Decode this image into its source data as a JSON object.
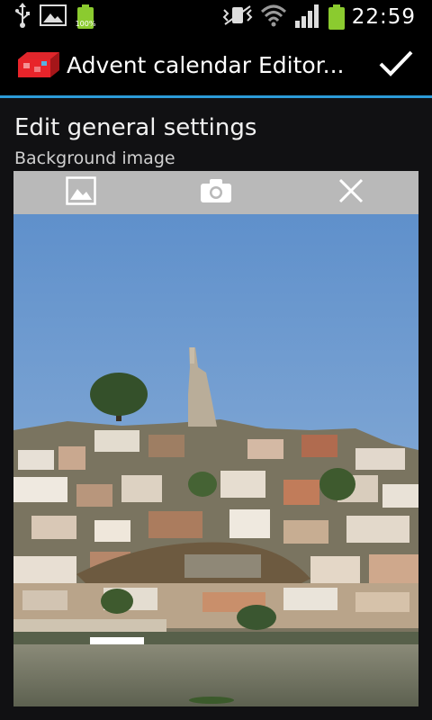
{
  "status_bar": {
    "battery_level_label": "100%",
    "time": "22:59",
    "icons": [
      "usb-icon",
      "image-notification-icon",
      "battery-icon",
      "vibrate-icon",
      "wifi-icon",
      "signal-icon",
      "battery-icon"
    ]
  },
  "action_bar": {
    "title": "Advent calendar Editor...",
    "done_icon": "checkmark-icon"
  },
  "settings": {
    "section_title": "Edit general settings",
    "background_label": "Background image"
  },
  "image_toolbar": {
    "items": [
      "gallery-icon",
      "camera-icon",
      "close-icon"
    ]
  },
  "colors": {
    "accent": "#2c9bd8",
    "battery": "#8bcb2f",
    "toolbar": "#b9b9b9",
    "sky": "#6a97cc"
  }
}
